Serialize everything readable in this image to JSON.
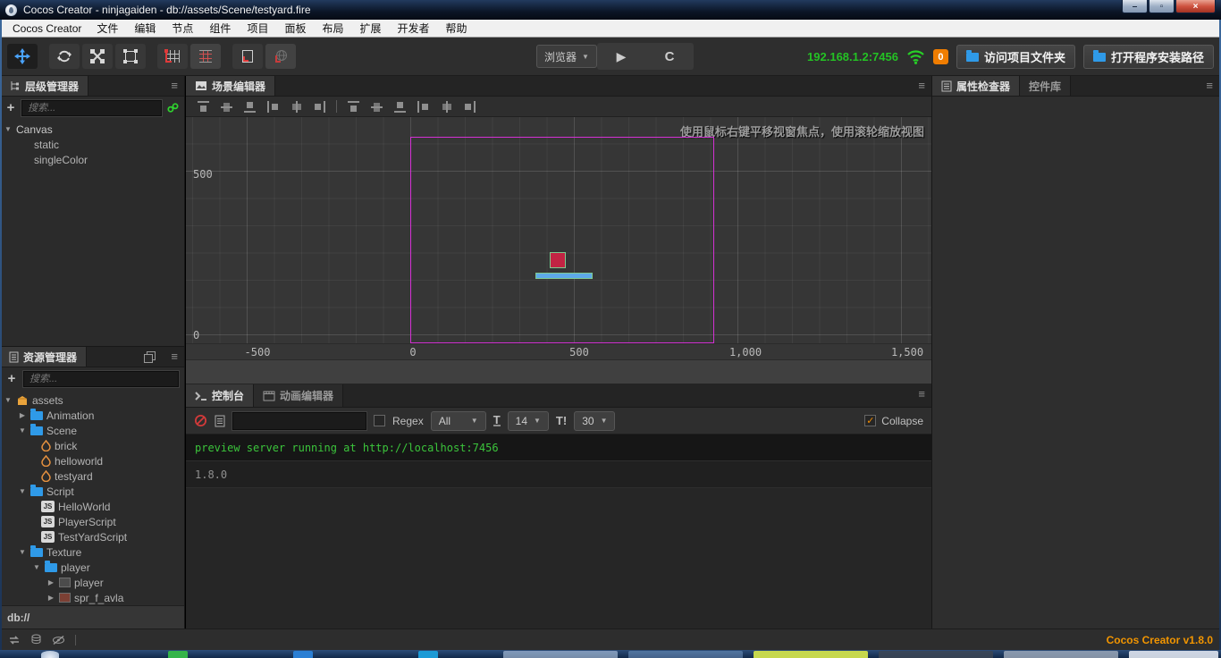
{
  "window": {
    "title": "Cocos Creator - ninjagaiden - db://assets/Scene/testyard.fire",
    "controls": {
      "minimize": "–",
      "maximize": "▫",
      "close": "×"
    }
  },
  "menu": {
    "brand": "Cocos Creator",
    "items": [
      "文件",
      "编辑",
      "节点",
      "组件",
      "项目",
      "面板",
      "布局",
      "扩展",
      "开发者",
      "帮助"
    ]
  },
  "toolbar": {
    "preview_browser": "浏览器",
    "ip": "192.168.1.2:7456",
    "compile_badge": "0",
    "open_project": "访问项目文件夹",
    "open_install": "打开程序安装路径"
  },
  "hierarchy": {
    "tab": "层级管理器",
    "search_placeholder": "搜索...",
    "nodes": [
      "Canvas",
      "static",
      "singleColor"
    ]
  },
  "assets": {
    "tab": "资源管理器",
    "search_placeholder": "搜索...",
    "js_badge": "JS",
    "status": "db://",
    "items": [
      {
        "label": "assets"
      },
      {
        "label": "Animation"
      },
      {
        "label": "Scene"
      },
      {
        "label": "brick"
      },
      {
        "label": "helloworld"
      },
      {
        "label": "testyard"
      },
      {
        "label": "Script"
      },
      {
        "label": "HelloWorld"
      },
      {
        "label": "PlayerScript"
      },
      {
        "label": "TestYardScript"
      },
      {
        "label": "Texture"
      },
      {
        "label": "player"
      },
      {
        "label": "player"
      },
      {
        "label": "spr_f_avla"
      }
    ]
  },
  "scene": {
    "tab": "场景编辑器",
    "hint": "使用鼠标右键平移视窗焦点，使用滚轮缩放视图",
    "ruler_y": [
      "500",
      "0"
    ],
    "ruler_x": [
      "-500",
      "0",
      "500",
      "1,000",
      "1,500"
    ],
    "colors": {
      "canvas_border": "#d431d4",
      "node_box_fill": "#c22443",
      "node_bar_fill": "#5da9e8",
      "node_outline": "#7fc98f"
    }
  },
  "console": {
    "tab": "控制台",
    "anim_tab": "动画编辑器",
    "regex_label": "Regex",
    "filter_value": "All",
    "font_icon": "T",
    "font_size_value": "14",
    "line_icon": "T!",
    "line_height_value": "30",
    "collapse_label": "Collapse",
    "collapse_check": "✓",
    "logs": [
      {
        "text": "preview server running at http://localhost:7456",
        "color": "green"
      },
      {
        "text": "1.8.0",
        "color": "gray"
      }
    ]
  },
  "inspector": {
    "tab": "属性检查器",
    "widgets_tab": "控件库"
  },
  "status": {
    "version": "Cocos Creator v1.8.0"
  }
}
